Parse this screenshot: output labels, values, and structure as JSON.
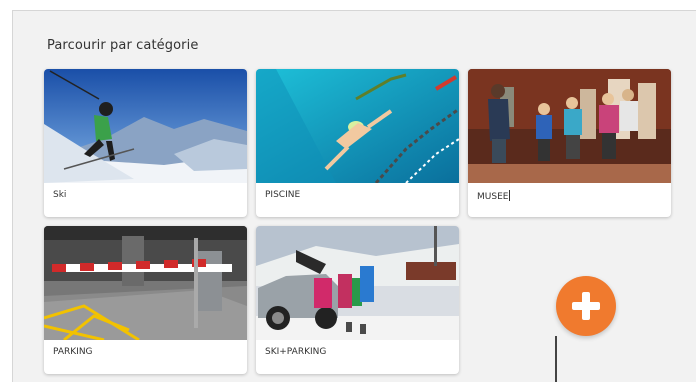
{
  "section": {
    "title": "Parcourir par catégorie"
  },
  "categories": [
    {
      "label": "Ski",
      "icon": "skier-photo"
    },
    {
      "label": "PISCINE",
      "icon": "swimmer-photo"
    },
    {
      "label": "MUSEE",
      "icon": "museum-visit-photo"
    },
    {
      "label": "PARKING",
      "icon": "parking-barrier-photo"
    },
    {
      "label": "SKI+PARKING",
      "icon": "ski-car-photo"
    }
  ],
  "add_button": {
    "icon": "plus-icon",
    "color": "#f07a2e"
  }
}
